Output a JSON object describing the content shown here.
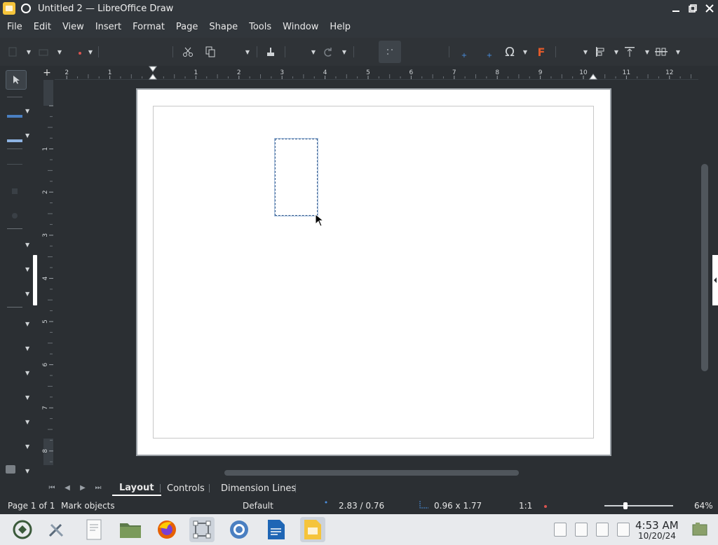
{
  "window": {
    "title": "Untitled 2 — LibreOffice Draw",
    "controls": [
      "minimize",
      "maximize",
      "close"
    ]
  },
  "menu": [
    "File",
    "Edit",
    "View",
    "Insert",
    "Format",
    "Page",
    "Shape",
    "Tools",
    "Window",
    "Help"
  ],
  "ruler": {
    "h_labels": [
      "2",
      "1",
      "1",
      "2",
      "3",
      "4",
      "5",
      "6",
      "7",
      "8",
      "9",
      "10",
      "11",
      "12"
    ],
    "v_labels": [
      "1",
      "2",
      "3",
      "4",
      "5",
      "6",
      "7",
      "8"
    ]
  },
  "tabs": {
    "items": [
      "Layout",
      "Controls",
      "Dimension Lines"
    ],
    "active": "Layout"
  },
  "status": {
    "page": "Page 1 of 1",
    "mode": "Mark objects",
    "layout": "Default",
    "position": "2.83 / 0.76",
    "size": "0.96 x 1.77",
    "scale": "1:1",
    "zoom": "64%"
  },
  "taskbar": {
    "time": "4:53 AM",
    "date": "10/20/24",
    "apps": [
      "kde-menu-icon",
      "settings-icon",
      "text-editor-icon",
      "file-manager-icon",
      "firefox-icon",
      "draw-icon",
      "chromium-icon",
      "writer-icon",
      "impress-icon"
    ]
  },
  "colors": {
    "accent": "#f5c43b",
    "selection": "#a9c2e0"
  }
}
